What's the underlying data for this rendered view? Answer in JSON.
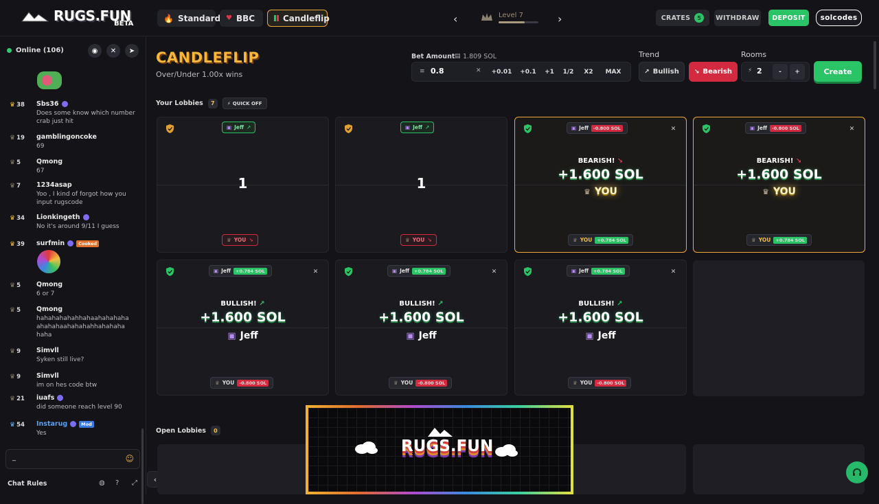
{
  "brand": {
    "name": "RUGS.FUN",
    "badge": "BETA"
  },
  "modes": [
    {
      "label": "Standard",
      "icon": "fire-icon",
      "active": false
    },
    {
      "label": "BBC",
      "icon": "heart-icon",
      "active": false
    },
    {
      "label": "Candleflip",
      "icon": "candle-icon",
      "active": true
    }
  ],
  "level": {
    "label": "Level 7",
    "progress": 0.65
  },
  "header": {
    "crates_label": "CRATES",
    "crates_count": "5",
    "withdraw_label": "WITHDRAW",
    "deposit_label": "DEPOSIT",
    "username": "solcodes"
  },
  "chat": {
    "online": "Online (106)",
    "messages": [
      {
        "level": "38",
        "user": "Sbs36",
        "text": "Does some know which number crab just hit"
      },
      {
        "level": "19",
        "user": "gamblingoncoke",
        "text": "69"
      },
      {
        "level": "5",
        "user": "Qmong",
        "text": "67"
      },
      {
        "level": "7",
        "user": "1234asap",
        "text": "Yoo , I kind of forgot how you input rugscode"
      },
      {
        "level": "34",
        "user": "Lionkingeth",
        "text": "No it's around 9/11 I guess"
      },
      {
        "level": "39",
        "user": "surfmin",
        "tag": "Cooked",
        "text": ""
      },
      {
        "level": "5",
        "user": "Qmong",
        "text": "6 or 7"
      },
      {
        "level": "5",
        "user": "Qmong",
        "text": "hahahahahahhahaahahahaha ahahahaahahahahhahahaha haha"
      },
      {
        "level": "9",
        "user": "Simvll",
        "text": "Syken still live?"
      },
      {
        "level": "9",
        "user": "Simvll",
        "text": "im on hes code btw"
      },
      {
        "level": "21",
        "user": "iuafs",
        "text": "did someone reach level 90"
      },
      {
        "level": "54",
        "user": "Instarug",
        "tag": "Mod",
        "text": "Yes"
      }
    ],
    "input_value": "_",
    "rules_label": "Chat Rules"
  },
  "game": {
    "title": "CANDLEFLIP",
    "subtitle": "Over/Under 1.00x wins",
    "bet_label": "Bet Amount",
    "balance": "1.809 SOL",
    "bet_value": "0.8",
    "bet_buttons": [
      "+0.01",
      "+0.1",
      "+1",
      "1/2",
      "X2",
      "MAX"
    ],
    "trend_label": "Trend",
    "bullish_label": "Bullish",
    "bearish_label": "Bearish",
    "rooms_label": "Rooms",
    "rooms_value": "2",
    "minus": "-",
    "plus": "+",
    "create_label": "Create"
  },
  "your_lobbies": {
    "label": "Your Lobbies",
    "count": "7",
    "quick_label": "QUICK OFF",
    "cards": [
      {
        "kind": "pending",
        "top_name": "Jeff",
        "center": "1",
        "bottom_name": "YOU"
      },
      {
        "kind": "pending",
        "top_name": "Jeff",
        "center": "1",
        "bottom_name": "YOU"
      },
      {
        "kind": "result",
        "win": true,
        "top_name": "Jeff",
        "top_val": "-0.800 SOL",
        "result": "BEARISH!",
        "amount": "+1.600 SOL",
        "winner": "YOU",
        "bottom_name": "YOU",
        "bottom_val": "+0.784 SOL"
      },
      {
        "kind": "result",
        "win": true,
        "top_name": "Jeff",
        "top_val": "-0.800 SOL",
        "result": "BEARISH!",
        "amount": "+1.600 SOL",
        "winner": "YOU",
        "bottom_name": "YOU",
        "bottom_val": "+0.784 SOL"
      },
      {
        "kind": "result",
        "win": false,
        "top_name": "Jeff",
        "top_val": "+0.784 SOL",
        "result": "BULLISH!",
        "amount": "+1.600 SOL",
        "winner": "Jeff",
        "bottom_name": "YOU",
        "bottom_val": "-0.800 SOL"
      },
      {
        "kind": "result",
        "win": false,
        "top_name": "Jeff",
        "top_val": "+0.784 SOL",
        "result": "BULLISH!",
        "amount": "+1.600 SOL",
        "winner": "Jeff",
        "bottom_name": "YOU",
        "bottom_val": "-0.800 SOL"
      },
      {
        "kind": "result",
        "win": false,
        "top_name": "Jeff",
        "top_val": "+0.784 SOL",
        "result": "BULLISH!",
        "amount": "+1.600 SOL",
        "winner": "Jeff",
        "bottom_name": "YOU",
        "bottom_val": "-0.800 SOL"
      }
    ]
  },
  "open_lobbies": {
    "label": "Open Lobbies",
    "count": "0"
  },
  "banner": {
    "text": "RUGS.FUN"
  },
  "colors": {
    "accent": "#f0a83a",
    "green": "#2ac466",
    "red": "#e0354a"
  }
}
